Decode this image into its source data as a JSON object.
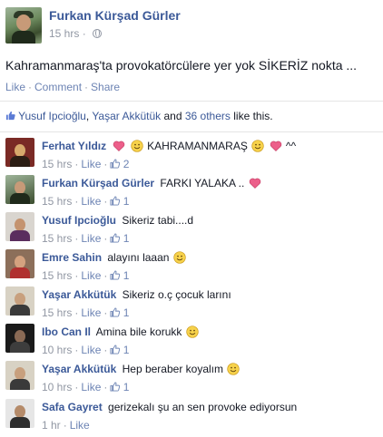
{
  "post": {
    "author": "Furkan Kürşad Gürler",
    "time": "15 hrs",
    "privacy_icon": "globe-icon",
    "text": "Kahramanmaraş'ta provokatörcülere yer yok SİKERİZ nokta ...",
    "actions": {
      "like": "Like",
      "comment": "Comment",
      "share": "Share",
      "separator": "·"
    }
  },
  "likes_summary": {
    "name1": "Yusuf Ipcioğlu",
    "separator": ",",
    "name2": "Yaşar Akkütük",
    "and_text": "and",
    "others": "36 others",
    "tail": "like this."
  },
  "comments": [
    {
      "name": "Ferhat Yıldız",
      "text_a": "",
      "text_b": "KAHRAMANMARAŞ",
      "text_c": "^^",
      "time": "15 hrs",
      "like": "Like",
      "count": "2",
      "emoji_before": [
        "heart-emoji",
        "smile-emoji"
      ],
      "emoji_after": [
        "smile-emoji",
        "heart-emoji"
      ]
    },
    {
      "name": "Furkan Kürşad Gürler",
      "text": "FARKI YALAKA ..",
      "time": "15 hrs",
      "like": "Like",
      "count": "1",
      "emoji_after": [
        "heart-emoji"
      ]
    },
    {
      "name": "Yusuf Ipcioğlu",
      "text": "Sikeriz tabi....d",
      "time": "15 hrs",
      "like": "Like",
      "count": "1"
    },
    {
      "name": "Emre Sahin",
      "text": "alayını laaan",
      "time": "15 hrs",
      "like": "Like",
      "count": "1",
      "emoji_after": [
        "smile-emoji"
      ]
    },
    {
      "name": "Yaşar Akkütük",
      "text": "Sikeriz o.ç çocuk larını",
      "time": "15 hrs",
      "like": "Like",
      "count": "1"
    },
    {
      "name": "Ibo Can Il",
      "text": "Amina bile korukk",
      "time": "10 hrs",
      "like": "Like",
      "count": "1",
      "emoji_after": [
        "smile-emoji"
      ]
    },
    {
      "name": "Yaşar Akkütük",
      "text": "Hep beraber koyalım",
      "time": "10 hrs",
      "like": "Like",
      "count": "1",
      "emoji_after": [
        "smile-emoji"
      ]
    },
    {
      "name": "Safa Gayret",
      "text": "gerizekalı şu an sen provoke ediyorsun",
      "time": "1 hr",
      "like": "Like"
    }
  ],
  "colors": {
    "link": "#3b5998",
    "action": "#6d84b4",
    "meta": "#9197a3",
    "heart": "#e0245e",
    "smile": "#f7c634"
  }
}
